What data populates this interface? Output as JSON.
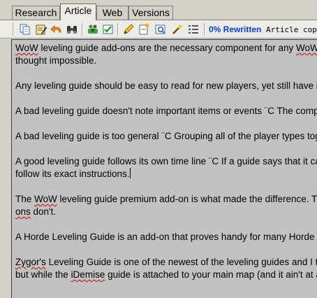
{
  "tabs": [
    {
      "label": "Research"
    },
    {
      "label": "Article",
      "active": true
    },
    {
      "label": "Web"
    },
    {
      "label": "Versions"
    }
  ],
  "toolbar": {
    "icons": [
      "copy-icon",
      "edit-document-icon",
      "undo-icon",
      "binoculars-icon",
      "group-icon",
      "checkmark-icon",
      "pencil-icon",
      "new-note-icon",
      "preview-icon",
      "magic-wand-icon",
      "list-icon"
    ],
    "rewritten_label": "0% Rewritten",
    "status_text": "Article copie"
  },
  "article": {
    "p1_a": "WoW",
    "p1_b": " leveling guide add-ons are the necessary component for any ",
    "p1_c": "WoW",
    "p1_d": " thought impossible.",
    "p2": "Any leveling guide should be easy to read for new players, yet still have i",
    "p3": "A bad leveling guide doesn't note important items or events ¨C The compl",
    "p4": "A bad leveling guide is too general ¨C Grouping all of the player types tog",
    "p5_a": "A good leveling guide follows its own time line ¨C If a guide says that it can",
    "p5_b": "follow its exact instructions.",
    "p6_a": "The ",
    "p6_b": "WoW",
    "p6_c": " leveling guide premium add-on is what made the difference.  The",
    "p6_d": "ons",
    "p6_e": " don't.",
    "p7": "A Horde Leveling Guide is an add-on that proves handy for many Horde p",
    "p8_a": "Zygor's",
    "p8_b": " Leveling Guide   is one of the newest of the leveling guides and I t",
    "p8_c": "but while the ",
    "p8_d": "iDemise",
    "p8_e": " guide is attached to your main map (and it ain't at all"
  },
  "colors": {
    "window_bg": "#d4d0c8",
    "editor_bg": "#c2c2c2",
    "rewritten_blue": "#0b3fd1",
    "spellcheck_red": "#d00000"
  }
}
